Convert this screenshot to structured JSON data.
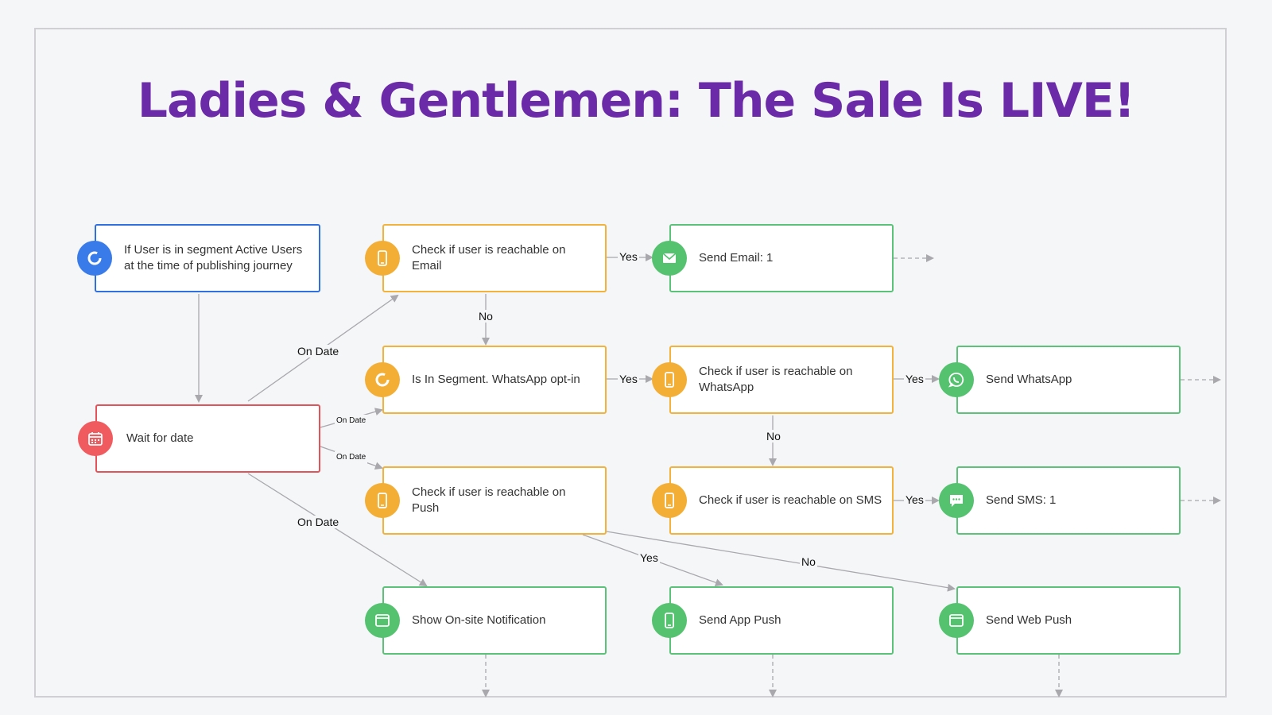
{
  "title": "Ladies & Gentlemen: The Sale Is LIVE!",
  "colors": {
    "title": "#6b2aa8",
    "trigger_border": "#2f6fe0",
    "wait_border": "#e5535a",
    "condition_border": "#f2b23c",
    "action_border": "#5cc27a"
  },
  "nodes": {
    "segment": {
      "label": "If User is in segment Active Users at the time of publishing journey",
      "icon": "segment-icon"
    },
    "wait": {
      "label": "Wait for date",
      "icon": "calendar-icon"
    },
    "email_check": {
      "label": "Check if user is reachable on Email",
      "icon": "phone-icon"
    },
    "whatsapp_segment": {
      "label": "Is In Segment. WhatsApp opt-in",
      "icon": "segment-icon"
    },
    "push_check": {
      "label": "Check if user is reachable on Push",
      "icon": "phone-icon"
    },
    "onsite": {
      "label": "Show On-site Notification",
      "icon": "browser-icon"
    },
    "send_email": {
      "label": "Send Email: 1",
      "icon": "mail-icon"
    },
    "whatsapp_check": {
      "label": "Check if user is reachable on WhatsApp",
      "icon": "phone-icon"
    },
    "sms_check": {
      "label": "Check if user is reachable on SMS",
      "icon": "phone-icon"
    },
    "app_push": {
      "label": "Send App Push",
      "icon": "phone-icon"
    },
    "send_whatsapp": {
      "label": "Send WhatsApp",
      "icon": "whatsapp-icon"
    },
    "send_sms": {
      "label": "Send SMS: 1",
      "icon": "chat-icon"
    },
    "web_push": {
      "label": "Send Web Push",
      "icon": "browser-icon"
    }
  },
  "edge_labels": {
    "on_date_top": "On Date",
    "on_date_mid1": "On Date",
    "on_date_mid2": "On Date",
    "on_date_bottom": "On Date",
    "email_yes": "Yes",
    "email_no": "No",
    "segment_yes": "Yes",
    "whatsapp_yes": "Yes",
    "whatsapp_no": "No",
    "sms_yes": "Yes",
    "push_yes": "Yes",
    "push_no": "No"
  }
}
